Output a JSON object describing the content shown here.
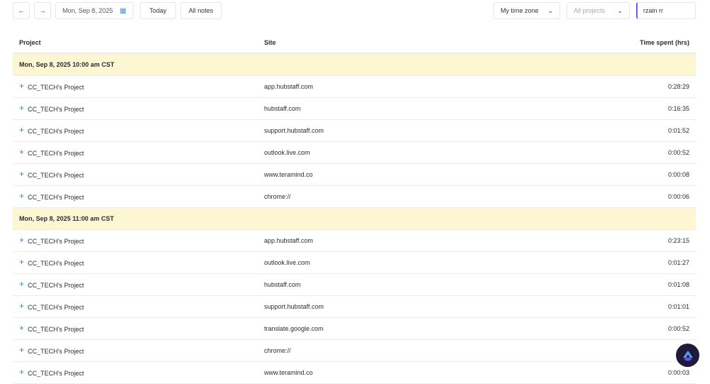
{
  "toolbar": {
    "prev_icon": "arrow-left",
    "next_icon": "arrow-right",
    "date": "Mon, Sep 8, 2025",
    "calendar_icon": "calendar-icon",
    "today": "Today",
    "all_notes": "All notes",
    "timezone": "My time zone",
    "projects_placeholder": "All projects",
    "user": "rzain rr"
  },
  "table": {
    "headers": {
      "project": "Project",
      "site": "Site",
      "time": "Time spent (hrs)"
    },
    "groups": [
      {
        "label": "Mon, Sep 8, 2025 10:00 am CST",
        "rows": [
          {
            "project": "CC_TECH's Project",
            "site": "app.hubstaff.com",
            "time": "0:28:29"
          },
          {
            "project": "CC_TECH's Project",
            "site": "hubstaff.com",
            "time": "0:16:35"
          },
          {
            "project": "CC_TECH's Project",
            "site": "support.hubstaff.com",
            "time": "0:01:52"
          },
          {
            "project": "CC_TECH's Project",
            "site": "outlook.live.com",
            "time": "0:00:52"
          },
          {
            "project": "CC_TECH's Project",
            "site": "www.teramind.co",
            "time": "0:00:08"
          },
          {
            "project": "CC_TECH's Project",
            "site": "chrome://",
            "time": "0:00:06"
          }
        ]
      },
      {
        "label": "Mon, Sep 8, 2025 11:00 am CST",
        "rows": [
          {
            "project": "CC_TECH's Project",
            "site": "app.hubstaff.com",
            "time": "0:23:15"
          },
          {
            "project": "CC_TECH's Project",
            "site": "outlook.live.com",
            "time": "0:01:27"
          },
          {
            "project": "CC_TECH's Project",
            "site": "hubstaff.com",
            "time": "0:01:08"
          },
          {
            "project": "CC_TECH's Project",
            "site": "support.hubstaff.com",
            "time": "0:01:01"
          },
          {
            "project": "CC_TECH's Project",
            "site": "translate.google.com",
            "time": "0:00:52"
          },
          {
            "project": "CC_TECH's Project",
            "site": "chrome://",
            "time": "0:0"
          },
          {
            "project": "CC_TECH's Project",
            "site": "www.teramind.co",
            "time": "0:00:03"
          }
        ]
      }
    ]
  },
  "colors": {
    "group_bg": "#fcf7d2",
    "accent": "#6c5ce7",
    "plus": "#4a7fd6"
  }
}
